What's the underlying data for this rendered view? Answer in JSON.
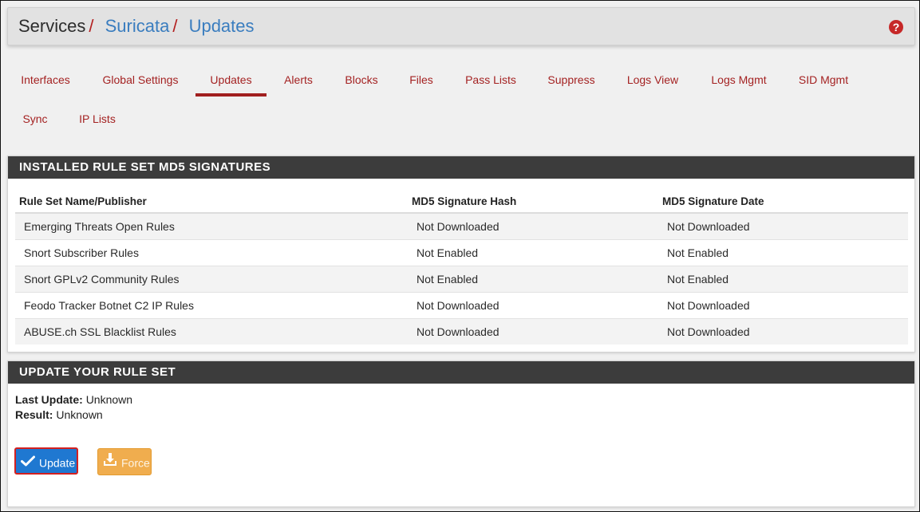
{
  "breadcrumb": {
    "root": "Services",
    "separator": "/",
    "items": [
      "Suricata",
      "Updates"
    ]
  },
  "help_icon": "question-circle-icon",
  "tabs": [
    {
      "label": "Interfaces",
      "active": false
    },
    {
      "label": "Global Settings",
      "active": false
    },
    {
      "label": "Updates",
      "active": true
    },
    {
      "label": "Alerts",
      "active": false
    },
    {
      "label": "Blocks",
      "active": false
    },
    {
      "label": "Files",
      "active": false
    },
    {
      "label": "Pass Lists",
      "active": false
    },
    {
      "label": "Suppress",
      "active": false
    },
    {
      "label": "Logs View",
      "active": false
    },
    {
      "label": "Logs Mgmt",
      "active": false
    },
    {
      "label": "SID Mgmt",
      "active": false
    },
    {
      "label": "Sync",
      "active": false
    },
    {
      "label": "IP Lists",
      "active": false
    }
  ],
  "signatures": {
    "title": "INSTALLED RULE SET MD5 SIGNATURES",
    "columns": [
      "Rule Set Name/Publisher",
      "MD5 Signature Hash",
      "MD5 Signature Date"
    ],
    "rows": [
      [
        "Emerging Threats Open Rules",
        "Not Downloaded",
        "Not Downloaded"
      ],
      [
        "Snort Subscriber Rules",
        "Not Enabled",
        "Not Enabled"
      ],
      [
        "Snort GPLv2 Community Rules",
        "Not Enabled",
        "Not Enabled"
      ],
      [
        "Feodo Tracker Botnet C2 IP Rules",
        "Not Downloaded",
        "Not Downloaded"
      ],
      [
        "ABUSE.ch SSL Blacklist Rules",
        "Not Downloaded",
        "Not Downloaded"
      ]
    ]
  },
  "update": {
    "title": "UPDATE YOUR RULE SET",
    "last_update_label": "Last Update:",
    "last_update_value": "Unknown",
    "result_label": "Result:",
    "result_value": "Unknown",
    "update_button": "Update",
    "force_button": "Force"
  },
  "colors": {
    "accent_red": "#a42222",
    "link_blue": "#3a7dbf",
    "update_blue": "#1f78d1",
    "force_orange": "#f0ad4e",
    "panel_header": "#3c3c3c"
  }
}
